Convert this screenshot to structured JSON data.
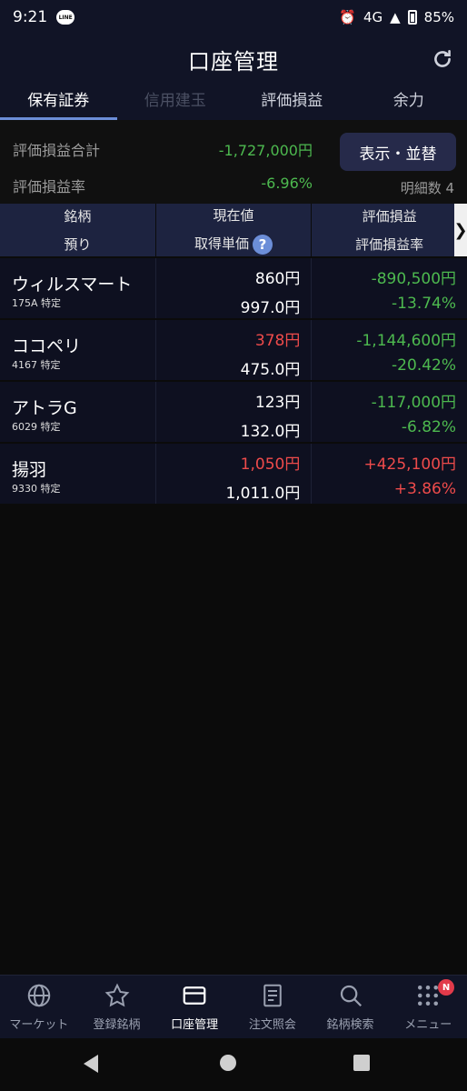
{
  "status": {
    "time": "9:21",
    "line_label": "LINE",
    "network": "4G",
    "battery": "85%"
  },
  "header": {
    "title": "口座管理"
  },
  "tabs": [
    {
      "label": "保有証券",
      "state": "active"
    },
    {
      "label": "信用建玉",
      "state": "disabled"
    },
    {
      "label": "評価損益",
      "state": "normal"
    },
    {
      "label": "余力",
      "state": "normal"
    }
  ],
  "summary": {
    "total_label": "評価損益合計",
    "total_value": "-1,727,000円",
    "rate_label": "評価損益率",
    "rate_value": "-6.96%",
    "display_button": "表示・並替",
    "detail_count": "明細数 4"
  },
  "table": {
    "headers": {
      "col1_line1": "銘柄",
      "col1_line2": "預り",
      "col2_line1": "現在値",
      "col2_line2": "取得単価",
      "col3_line1": "評価損益",
      "col3_line2": "評価損益率",
      "help": "?",
      "more": "❯"
    },
    "rows": [
      {
        "name": "ウィルスマート",
        "code": "175A 特定",
        "price": "860円",
        "price_color": "white",
        "cost": "997.0円",
        "pl": "-890,500円",
        "pl_rate": "-13.74%",
        "pl_color": "green"
      },
      {
        "name": "ココペリ",
        "code": "4167 特定",
        "price": "378円",
        "price_color": "red",
        "cost": "475.0円",
        "pl": "-1,144,600円",
        "pl_rate": "-20.42%",
        "pl_color": "green"
      },
      {
        "name": "アトラG",
        "code": "6029 特定",
        "price": "123円",
        "price_color": "white",
        "cost": "132.0円",
        "pl": "-117,000円",
        "pl_rate": "-6.82%",
        "pl_color": "green"
      },
      {
        "name": "揚羽",
        "code": "9330 特定",
        "price": "1,050円",
        "price_color": "red",
        "cost": "1,011.0円",
        "pl": "+425,100円",
        "pl_rate": "+3.86%",
        "pl_color": "red"
      }
    ]
  },
  "nav": [
    {
      "label": "マーケット",
      "icon": "globe-icon"
    },
    {
      "label": "登録銘柄",
      "icon": "star-icon"
    },
    {
      "label": "口座管理",
      "icon": "card-icon",
      "active": true
    },
    {
      "label": "注文照会",
      "icon": "document-icon"
    },
    {
      "label": "銘柄検索",
      "icon": "search-icon"
    },
    {
      "label": "メニュー",
      "icon": "grid-icon",
      "badge": "N"
    }
  ],
  "colors": {
    "green": "#4db94f",
    "red": "#ef4b4b",
    "accent": "#6c8ed8",
    "header_bg": "#111426"
  }
}
